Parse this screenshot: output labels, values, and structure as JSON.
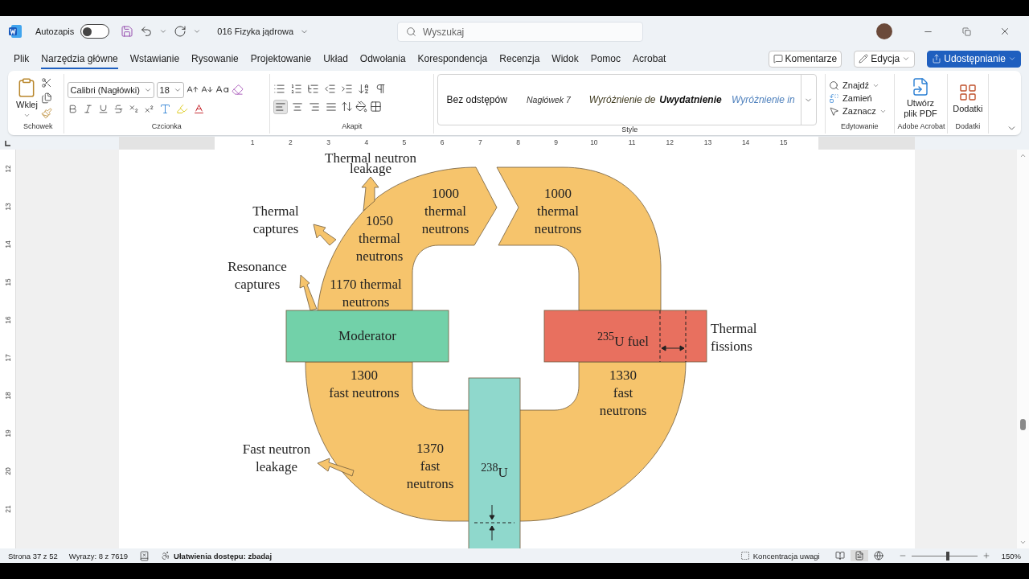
{
  "title_bar": {
    "autosave_label": "Autozapis",
    "autosave_on": false,
    "document_title": "016 Fizyka jądrowa",
    "search": {
      "placeholder": "Wyszukaj"
    }
  },
  "menu_tabs": [
    {
      "label": "Plik",
      "selected": false
    },
    {
      "label": "Narzędzia główne",
      "selected": true
    },
    {
      "label": "Wstawianie",
      "selected": false
    },
    {
      "label": "Rysowanie",
      "selected": false
    },
    {
      "label": "Projektowanie",
      "selected": false
    },
    {
      "label": "Układ",
      "selected": false
    },
    {
      "label": "Odwołania",
      "selected": false
    },
    {
      "label": "Korespondencja",
      "selected": false
    },
    {
      "label": "Recenzja",
      "selected": false
    },
    {
      "label": "Widok",
      "selected": false
    },
    {
      "label": "Pomoc",
      "selected": false
    },
    {
      "label": "Acrobat",
      "selected": false
    }
  ],
  "header_buttons": {
    "comments": "Komentarze",
    "editing": "Edycja",
    "share": "Udostępnianie"
  },
  "ribbon": {
    "clipboard": {
      "paste": "Wklej",
      "group": "Schowek"
    },
    "font": {
      "name": "Calibri (Nagłówki)",
      "size": "18",
      "group": "Czcionka"
    },
    "paragraph": {
      "group": "Akapit",
      "alignments": [
        {
          "kind": "left",
          "selected": true
        },
        {
          "kind": "center",
          "selected": false
        },
        {
          "kind": "right",
          "selected": false
        },
        {
          "kind": "justify",
          "selected": false
        }
      ]
    },
    "styles": {
      "group": "Style",
      "items": [
        {
          "label": "Bez odstępów",
          "kind": "plain"
        },
        {
          "label": "Nagłówek 7",
          "kind": "heading"
        },
        {
          "label": "Wyróżnienie de",
          "kind": "subtle"
        },
        {
          "label": "Uwydatnienie",
          "kind": "emphasis"
        },
        {
          "label": "Wyróżnienie in",
          "kind": "intense"
        }
      ]
    },
    "editing": {
      "group": "Edytowanie",
      "find": "Znajdź",
      "replace": "Zamień",
      "select": "Zaznacz"
    },
    "acrobat": {
      "group": "Adobe Acrobat",
      "create_pdf": "Utwórz\nplik PDF"
    },
    "addins": {
      "group": "Dodatki",
      "button": "Dodatki"
    }
  },
  "ruler": {
    "horizontal": [
      "1",
      "2",
      "3",
      "4",
      "5",
      "6",
      "7",
      "8",
      "9",
      "10",
      "11",
      "12",
      "13",
      "14",
      "15"
    ],
    "vertical": [
      "12",
      "13",
      "14",
      "15",
      "16",
      "17",
      "18",
      "19",
      "20",
      "21"
    ]
  },
  "figure": {
    "labels": [
      {
        "text": "Thermal neutron"
      },
      {
        "text": "leakage"
      },
      {
        "text": "Thermal\ncaptures"
      },
      {
        "text": "1050\nthermal\nneutrons"
      },
      {
        "text": "1000\nthermal\nneutrons"
      },
      {
        "text": "1000\nthermal\nneutrons"
      },
      {
        "text": "Resonance\ncaptures"
      },
      {
        "text": "1170 thermal\nneutrons"
      },
      {
        "text": "Moderator"
      },
      {
        "text": "$^{235}$U fuel"
      },
      {
        "text": "Thermal\nfissions"
      },
      {
        "text": "1300\nfast neutrons"
      },
      {
        "text": "1330\nfast\nneutrons"
      },
      {
        "text": "Fast neutron\nleakage"
      },
      {
        "text": "1370\nfast\nneutrons"
      },
      {
        "text": "$^{238}$U"
      }
    ]
  },
  "status_bar": {
    "page": "Strona 37 z 52",
    "words": "Wyrazy: 8 z 7619",
    "accessibility": "Ułatwienia dostępu: zbadaj",
    "focus": "Koncentracja uwagi",
    "views": [
      {
        "kind": "read",
        "selected": false
      },
      {
        "kind": "print",
        "selected": true
      },
      {
        "kind": "web",
        "selected": false
      }
    ],
    "zoom": {
      "level": 0.55,
      "reading": "150%"
    }
  }
}
